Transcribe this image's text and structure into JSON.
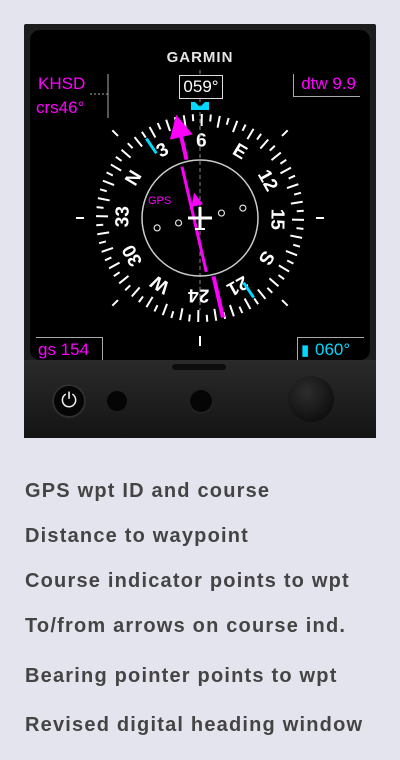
{
  "device": {
    "brand": "GARMIN",
    "heading_window": "059°",
    "waypoint_id": "KHSD",
    "course": "crs46°",
    "distance": "dtw 9.9",
    "ground_speed": "gs 154",
    "heading_bug": "060°",
    "gps_label": "GPS",
    "compass_labels": [
      "N",
      "3",
      "6",
      "E",
      "12",
      "15",
      "S",
      "21",
      "24",
      "W",
      "30",
      "33"
    ],
    "current_heading_deg": 59,
    "course_deg": 46,
    "bearing_deg": 25,
    "colors": {
      "magenta": "#ff00ff",
      "cyan": "#00d8ff",
      "background": "#e4e4ee"
    },
    "icons": [
      "power-icon",
      "heading-bug-icon",
      "airplane-icon"
    ]
  },
  "annotations": [
    "GPS wpt ID and course",
    "Distance to waypoint",
    "Course indicator points to wpt",
    "To/from arrows on course ind.",
    "Bearing pointer points to wpt",
    "Revised digital heading window"
  ]
}
